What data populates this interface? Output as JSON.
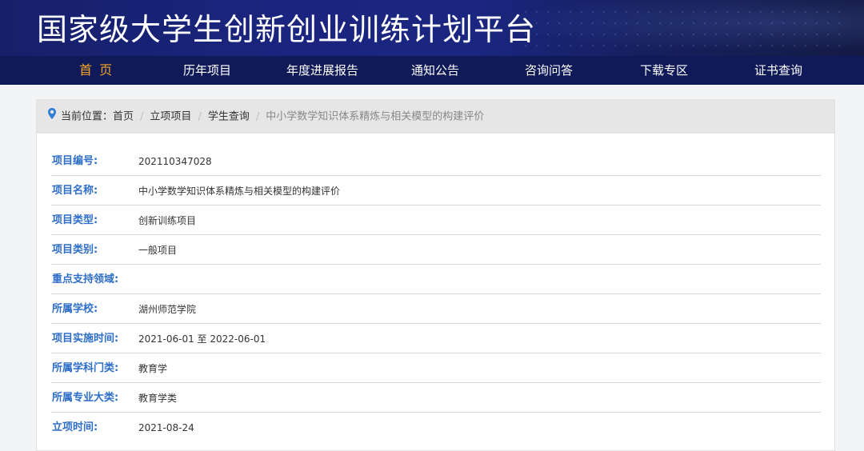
{
  "header": {
    "title": "国家级大学生创新创业训练计划平台"
  },
  "nav": [
    {
      "label": "首 页"
    },
    {
      "label": "历年项目"
    },
    {
      "label": "年度进展报告"
    },
    {
      "label": "通知公告"
    },
    {
      "label": "咨询问答"
    },
    {
      "label": "下载专区"
    },
    {
      "label": "证书查询"
    }
  ],
  "breadcrumb": {
    "prefix": "当前位置：",
    "items": [
      "首页",
      "立项项目",
      "学生查询"
    ],
    "current": "中小学数学知识体系精炼与相关模型的构建评价"
  },
  "fields": [
    {
      "label": "项目编号:",
      "value": "202110347028"
    },
    {
      "label": "项目名称:",
      "value": "中小学数学知识体系精炼与相关模型的构建评价"
    },
    {
      "label": "项目类型:",
      "value": "创新训练项目"
    },
    {
      "label": "项目类别:",
      "value": "一般项目"
    },
    {
      "label": "重点支持领域:",
      "value": ""
    },
    {
      "label": "所属学校:",
      "value": "湖州师范学院"
    },
    {
      "label": "项目实施时间:",
      "value": "2021-06-01 至 2022-06-01"
    },
    {
      "label": "所属学科门类:",
      "value": "教育学"
    },
    {
      "label": "所属专业大类:",
      "value": "教育学类"
    },
    {
      "label": "立项时间:",
      "value": "2021-08-24"
    }
  ],
  "colors": {
    "banner": "#1b2580",
    "nav_bg": "#101a58",
    "nav_active": "#f6a623",
    "label_blue": "#2f6ec7",
    "breadcrumb_bg": "#e6e6e6"
  }
}
